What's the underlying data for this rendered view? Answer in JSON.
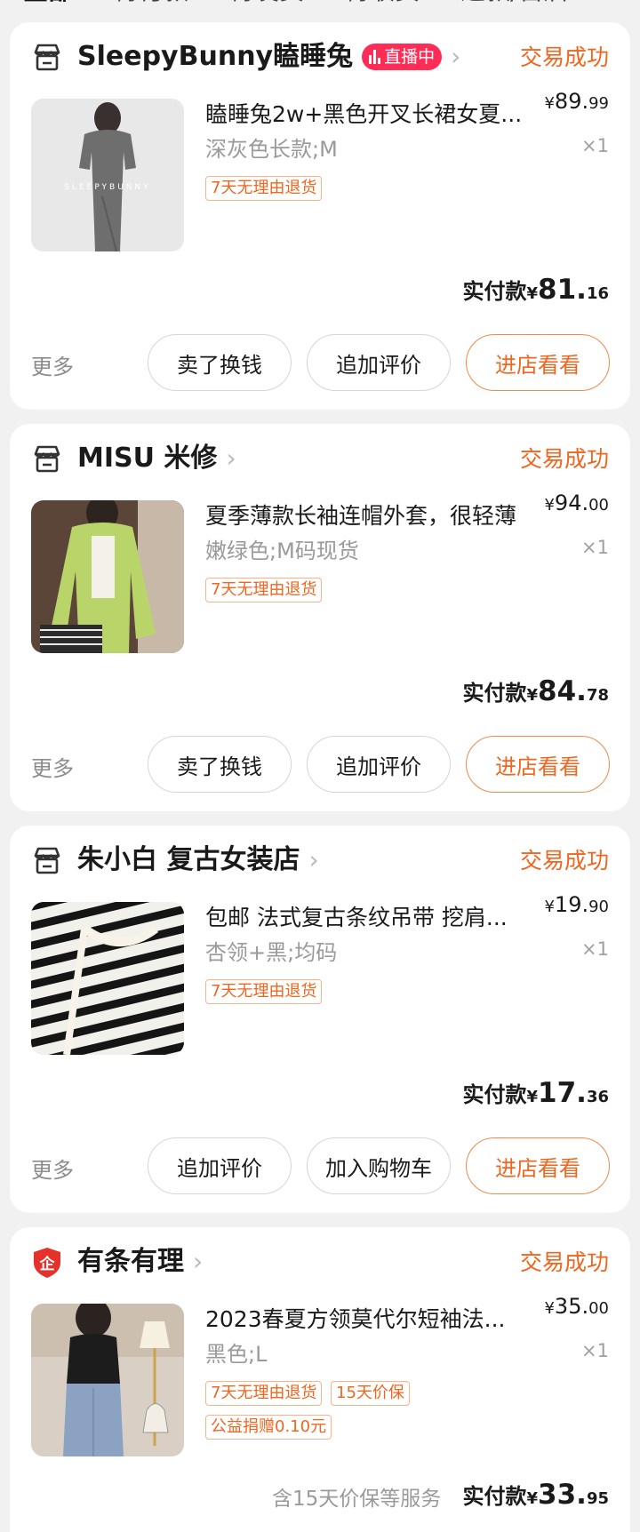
{
  "tabs": [
    "全部",
    "待付款",
    "待发货",
    "待收货",
    "退款/售后"
  ],
  "colors": {
    "accent": "#f0661f",
    "live": "#ff2d55",
    "background": "#f1f1f1"
  },
  "orders": [
    {
      "store_icon": "store-icon",
      "store_name": "SleepyBunny瞌睡兔",
      "live_badge": "直播中",
      "status": "交易成功",
      "title": "瞌睡兔2w+黑色开叉长裙女夏...",
      "variant": "深灰色长款;M",
      "tags": [
        "7天无理由退货"
      ],
      "price": {
        "currency": "¥",
        "int": "89.",
        "dec": "99"
      },
      "qty": "×1",
      "paid": {
        "label": "实付款",
        "currency": "¥",
        "int": "81.",
        "dec": "16"
      },
      "more": "更多",
      "buttons": [
        "卖了换钱",
        "追加评价",
        "进店看看"
      ],
      "image_text": "SLEEPYBUNNY"
    },
    {
      "store_icon": "store-icon",
      "store_name": "MISU 米修",
      "status": "交易成功",
      "title": "夏季薄款长袖连帽外套，很轻薄",
      "variant": "嫩绿色;M码现货",
      "tags": [
        "7天无理由退货"
      ],
      "price": {
        "currency": "¥",
        "int": "94.",
        "dec": "00"
      },
      "qty": "×1",
      "paid": {
        "label": "实付款",
        "currency": "¥",
        "int": "84.",
        "dec": "78"
      },
      "more": "更多",
      "buttons": [
        "卖了换钱",
        "追加评价",
        "进店看看"
      ]
    },
    {
      "store_icon": "store-icon",
      "store_name": "朱小白 复古女装店",
      "status": "交易成功",
      "title": "包邮 法式复古条纹吊带 挖肩...",
      "variant": "杏领+黑;均码",
      "tags": [
        "7天无理由退货"
      ],
      "price": {
        "currency": "¥",
        "int": "19.",
        "dec": "90"
      },
      "qty": "×1",
      "paid": {
        "label": "实付款",
        "currency": "¥",
        "int": "17.",
        "dec": "36"
      },
      "more": "更多",
      "buttons": [
        "追加评价",
        "加入购物车",
        "进店看看"
      ]
    },
    {
      "store_icon": "enterprise-shield-icon",
      "store_icon_text": "企",
      "store_name": "有条有理",
      "status": "交易成功",
      "title": "2023春夏方领莫代尔短袖法...",
      "variant": "黑色;L",
      "tags": [
        "7天无理由退货",
        "15天价保",
        "公益捐赠0.10元"
      ],
      "price": {
        "currency": "¥",
        "int": "35.",
        "dec": "00"
      },
      "qty": "×1",
      "service_note": "含15天价保等服务",
      "paid": {
        "label": "实付款",
        "currency": "¥",
        "int": "33.",
        "dec": "95"
      }
    }
  ]
}
